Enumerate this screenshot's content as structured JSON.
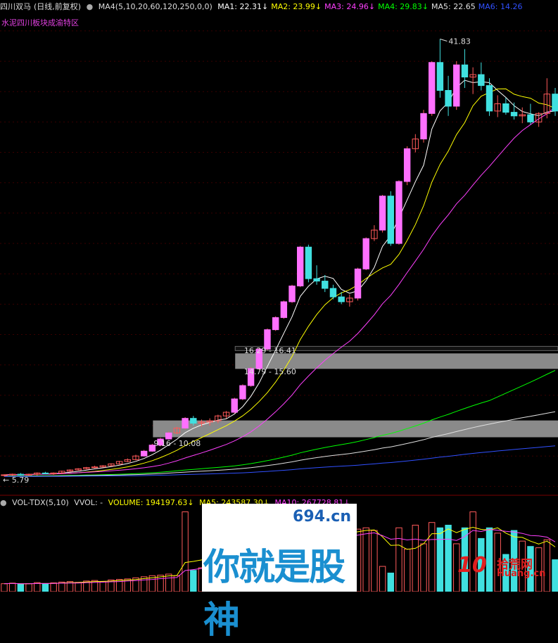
{
  "header": {
    "stock": "四川双马",
    "mode": "(日线,前复权)",
    "indicator": "MA4(5,10,20,60,120,250,0,0)",
    "ma_values": [
      {
        "label": "MA1: 22.31↓",
        "color": "#ffffff"
      },
      {
        "label": "MA2: 23.99↓",
        "color": "#ffff00"
      },
      {
        "label": "MA3: 24.96↓",
        "color": "#ff40ff"
      },
      {
        "label": "MA4: 29.83↓",
        "color": "#00ff00"
      },
      {
        "label": "MA5: 22.65",
        "color": "#e0e0e0"
      },
      {
        "label": "MA6: 14.26",
        "color": "#3050ff"
      }
    ]
  },
  "sector_label": "水泥四川板块成渝特区",
  "volume_header": {
    "name": "VOL-TDX(5,10)",
    "vvol": "VVOL: -",
    "volume": "VOLUME: 194197.63↓",
    "ma5": "MA5: 243587.30↓",
    "ma10": "MA10: 267728.81↓"
  },
  "annotations": {
    "high": "41.83",
    "low": "5.79",
    "zone1": "16.29 - 16.41",
    "zone2": "14.79 - 15.60",
    "zone3": "9.16 - 10.08"
  },
  "watermark": {
    "domain": "694.cn",
    "text": "你就是股神"
  },
  "site_logo": {
    "num": "10",
    "title": "拾荒网",
    "sub": "Huang.cn"
  },
  "colors": {
    "up": "#ff5a5a",
    "up_fill": "#ff70ff",
    "down": "#40e0e0",
    "bg": "#000000"
  },
  "chart_data": [
    {
      "type": "candlestick",
      "title": "四川双马",
      "ylim": [
        4.5,
        44.0
      ],
      "price_zones": [
        [
          16.29,
          16.41
        ],
        [
          14.79,
          15.6
        ],
        [
          9.16,
          10.08
        ]
      ],
      "candles": [
        [
          5.9,
          6.0,
          5.8,
          5.95
        ],
        [
          5.95,
          6.05,
          5.85,
          6.0
        ],
        [
          6.0,
          6.1,
          5.9,
          5.95
        ],
        [
          5.95,
          6.05,
          5.85,
          6.0
        ],
        [
          6.0,
          6.15,
          5.9,
          6.1
        ],
        [
          6.1,
          6.2,
          6.0,
          6.05
        ],
        [
          6.05,
          6.15,
          5.95,
          6.1
        ],
        [
          6.1,
          6.3,
          6.05,
          6.25
        ],
        [
          6.25,
          6.4,
          6.2,
          6.35
        ],
        [
          6.35,
          6.5,
          6.3,
          6.45
        ],
        [
          6.45,
          6.6,
          6.4,
          6.55
        ],
        [
          6.55,
          6.7,
          6.5,
          6.6
        ],
        [
          6.6,
          6.75,
          6.55,
          6.7
        ],
        [
          6.7,
          6.9,
          6.65,
          6.85
        ],
        [
          6.85,
          7.1,
          6.8,
          7.05
        ],
        [
          7.05,
          7.3,
          7.0,
          7.2
        ],
        [
          7.2,
          7.6,
          7.15,
          7.5
        ],
        [
          7.5,
          8.0,
          7.45,
          7.9
        ],
        [
          7.9,
          8.5,
          7.85,
          8.4
        ],
        [
          8.4,
          9.0,
          8.3,
          8.9
        ],
        [
          8.9,
          9.5,
          8.85,
          9.4
        ],
        [
          9.4,
          9.9,
          9.3,
          9.8
        ],
        [
          9.8,
          10.7,
          9.7,
          10.6
        ],
        [
          10.6,
          10.8,
          10.0,
          10.2
        ],
        [
          10.2,
          10.5,
          9.9,
          10.3
        ],
        [
          10.3,
          10.6,
          10.0,
          10.4
        ],
        [
          10.4,
          10.9,
          10.2,
          10.8
        ],
        [
          10.8,
          11.2,
          10.6,
          11.1
        ],
        [
          11.1,
          12.3,
          11.0,
          12.2
        ],
        [
          12.2,
          13.4,
          12.1,
          13.3
        ],
        [
          13.3,
          14.8,
          13.2,
          14.7
        ],
        [
          14.7,
          16.4,
          14.6,
          16.3
        ],
        [
          16.3,
          18.0,
          16.2,
          17.9
        ],
        [
          17.9,
          19.0,
          17.8,
          18.9
        ],
        [
          18.9,
          20.3,
          18.8,
          20.2
        ],
        [
          20.2,
          21.6,
          20.1,
          21.5
        ],
        [
          21.5,
          24.8,
          21.4,
          24.7
        ],
        [
          24.7,
          24.9,
          21.8,
          22.1
        ],
        [
          22.1,
          23.2,
          21.6,
          21.9
        ],
        [
          21.9,
          22.4,
          21.0,
          21.3
        ],
        [
          21.3,
          21.6,
          20.4,
          20.6
        ],
        [
          20.6,
          21.0,
          20.0,
          20.2
        ],
        [
          20.2,
          20.8,
          19.8,
          20.5
        ],
        [
          20.5,
          23.0,
          20.3,
          22.9
        ],
        [
          22.9,
          25.5,
          22.8,
          25.4
        ],
        [
          25.4,
          26.5,
          25.2,
          26.1
        ],
        [
          26.1,
          29.0,
          25.9,
          28.9
        ],
        [
          28.9,
          29.3,
          24.8,
          25.0
        ],
        [
          25.0,
          30.2,
          24.9,
          30.1
        ],
        [
          30.1,
          33.0,
          29.8,
          32.8
        ],
        [
          32.8,
          34.0,
          32.5,
          33.6
        ],
        [
          33.6,
          36.0,
          33.3,
          35.7
        ],
        [
          35.7,
          40.0,
          35.5,
          39.9
        ],
        [
          39.9,
          41.83,
          37.0,
          37.6
        ],
        [
          37.6,
          38.8,
          35.5,
          36.3
        ],
        [
          36.3,
          40.0,
          36.0,
          39.7
        ],
        [
          39.7,
          41.0,
          37.8,
          38.7
        ],
        [
          38.7,
          39.5,
          37.3,
          38.9
        ],
        [
          38.9,
          39.9,
          37.6,
          38.0
        ],
        [
          38.0,
          38.6,
          35.5,
          35.9
        ],
        [
          35.9,
          37.2,
          35.4,
          36.5
        ],
        [
          36.5,
          37.0,
          35.6,
          35.8
        ],
        [
          35.8,
          36.6,
          35.2,
          35.5
        ],
        [
          35.5,
          36.2,
          34.9,
          35.6
        ],
        [
          35.6,
          36.5,
          34.8,
          35.0
        ],
        [
          35.0,
          35.8,
          34.6,
          35.7
        ],
        [
          35.7,
          38.6,
          35.3,
          37.3
        ],
        [
          37.3,
          37.8,
          35.5,
          35.9
        ]
      ]
    },
    {
      "type": "bar",
      "title": "VOL-TDX(5,10)",
      "ylim": [
        0,
        320000
      ],
      "values": [
        30000,
        32000,
        28000,
        30000,
        34000,
        30000,
        33000,
        36000,
        38000,
        35000,
        40000,
        42000,
        38000,
        44000,
        46000,
        48000,
        52000,
        56000,
        60000,
        62000,
        66000,
        60000,
        300000,
        80000,
        90000,
        110000,
        120000,
        140000,
        150000,
        160000,
        170000,
        175000,
        180000,
        185000,
        190000,
        195000,
        200000,
        205000,
        210000,
        215000,
        220000,
        225000,
        230000,
        235000,
        240000,
        230000,
        95000,
        70000,
        240000,
        160000,
        250000,
        180000,
        260000,
        240000,
        250000,
        180000,
        240000,
        300000,
        200000,
        240000,
        220000,
        140000,
        230000,
        190000,
        170000,
        165000,
        195000,
        120000
      ]
    }
  ]
}
